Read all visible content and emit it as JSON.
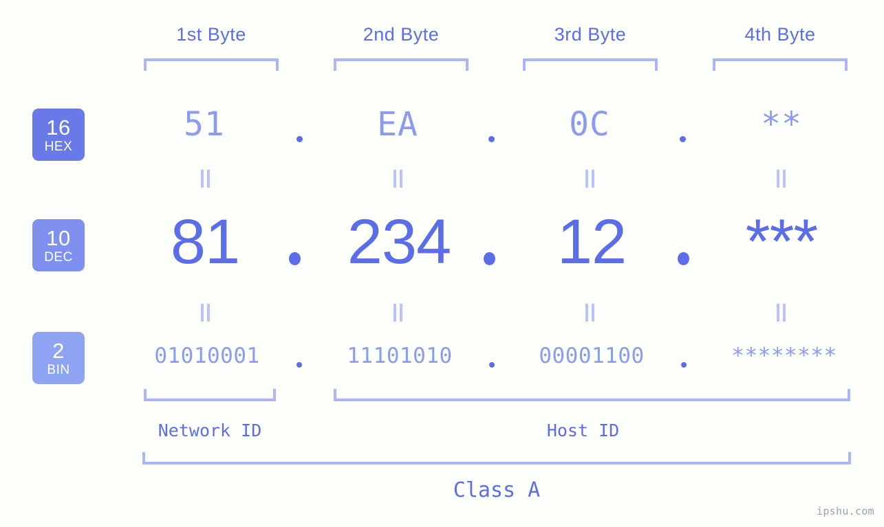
{
  "meta": {
    "background_color": "#fcfefa",
    "accent_color": "#5b6ee8",
    "accent_light_color": "#8a9bf0",
    "bracket_color": "#aab6f9",
    "watermark": "ipshu.com"
  },
  "columns": [
    {
      "title": "1st Byte"
    },
    {
      "title": "2nd Byte"
    },
    {
      "title": "3rd Byte"
    },
    {
      "title": "4th Byte"
    }
  ],
  "bases": [
    {
      "number": "16",
      "abbr": "HEX",
      "color": "#6979e8"
    },
    {
      "number": "10",
      "abbr": "DEC",
      "color": "#8090ee"
    },
    {
      "number": "2",
      "abbr": "BIN",
      "color": "#8fa3f3"
    }
  ],
  "rows": {
    "hex": {
      "octets": [
        "51",
        "EA",
        "0C",
        "**"
      ]
    },
    "dec": {
      "octets": [
        "81",
        "234",
        "12",
        "***"
      ]
    },
    "bin": {
      "octets": [
        "01010001",
        "11101010",
        "00001100",
        "********"
      ]
    }
  },
  "separators": {
    "dot": "."
  },
  "equals_mark": "=",
  "sections": {
    "network_id": "Network ID",
    "host_id": "Host ID",
    "class": "Class A"
  }
}
